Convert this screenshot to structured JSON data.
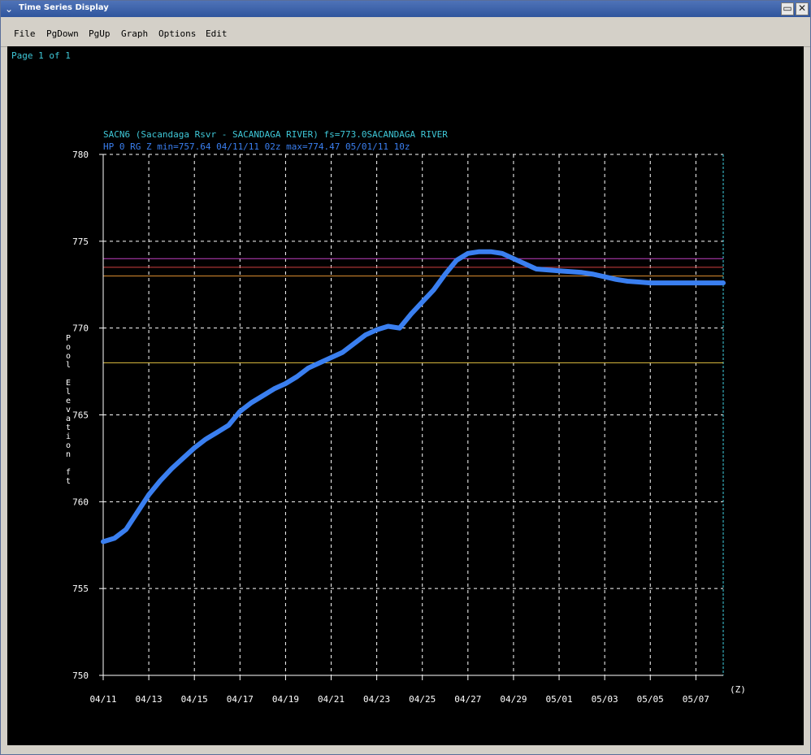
{
  "window": {
    "title": "Time Series Display",
    "menu_glyph": "⌄",
    "minimize_glyph": "▭",
    "close_glyph": "✕"
  },
  "menu": {
    "file": "File",
    "pgdown": "PgDown",
    "pgup": "PgUp",
    "graph": "Graph",
    "options": "Options",
    "edit": "Edit"
  },
  "page_label": "Page 1 of 1",
  "chart_data": {
    "type": "line",
    "title": "SACN6 (Sacandaga Rsvr - SACANDAGA RIVER) fs=773.0SACANDAGA RIVER",
    "subtitle": "HP 0 RG Z min=757.64 04/11/11 02z max=774.47 05/01/11 10z",
    "ylabel": "Pool Elevation ft",
    "xunit_label": "(Z)",
    "ylim": [
      750,
      780
    ],
    "yticks": [
      "780",
      "775",
      "770",
      "765",
      "760",
      "755",
      "750"
    ],
    "xticks": [
      "04/11",
      "04/13",
      "04/15",
      "04/17",
      "04/19",
      "04/21",
      "04/23",
      "04/25",
      "04/27",
      "04/29",
      "05/01",
      "05/03",
      "05/05",
      "05/07"
    ],
    "grid": true,
    "colors": {
      "series": "#3a7ff0",
      "title": "#3fc8d8",
      "axis_text": "#ffffff",
      "grid": "#ffffff",
      "now_line": "#40d0e0"
    },
    "thresholds": [
      {
        "value": 774.0,
        "color": "#c040c0"
      },
      {
        "value": 773.5,
        "color": "#d04040"
      },
      {
        "value": 773.0,
        "color": "#e09030"
      },
      {
        "value": 768.0,
        "color": "#e0c040"
      }
    ],
    "series": [
      {
        "x_days": [
          0,
          0.5,
          1,
          1.5,
          2,
          2.5,
          3,
          3.5,
          4,
          4.5,
          5,
          5.5,
          6,
          6.5,
          7,
          7.5,
          8,
          8.5,
          9,
          9.5,
          10,
          10.5,
          11,
          11.5,
          12,
          12.5,
          13,
          13.5,
          14,
          14.5,
          15,
          15.5,
          16,
          16.5,
          17,
          17.5,
          18,
          18.5,
          19,
          19.5,
          20,
          20.5,
          21,
          21.5,
          22,
          22.5,
          23,
          23.5,
          24,
          24.5,
          25,
          25.5,
          26,
          26.5,
          27,
          27.2
        ],
        "values": [
          757.7,
          757.9,
          758.4,
          759.4,
          760.4,
          761.2,
          761.9,
          762.5,
          763.1,
          763.6,
          764.0,
          764.4,
          765.2,
          765.7,
          766.1,
          766.5,
          766.8,
          767.2,
          767.7,
          768.0,
          768.3,
          768.6,
          769.1,
          769.6,
          769.9,
          770.1,
          770.0,
          770.8,
          771.5,
          772.2,
          773.1,
          773.9,
          774.3,
          774.4,
          774.4,
          774.3,
          774.0,
          773.7,
          773.4,
          773.35,
          773.3,
          773.25,
          773.2,
          773.1,
          772.95,
          772.8,
          772.7,
          772.65,
          772.6,
          772.6,
          772.6,
          772.6,
          772.6,
          772.6,
          772.6,
          772.6
        ]
      }
    ]
  }
}
